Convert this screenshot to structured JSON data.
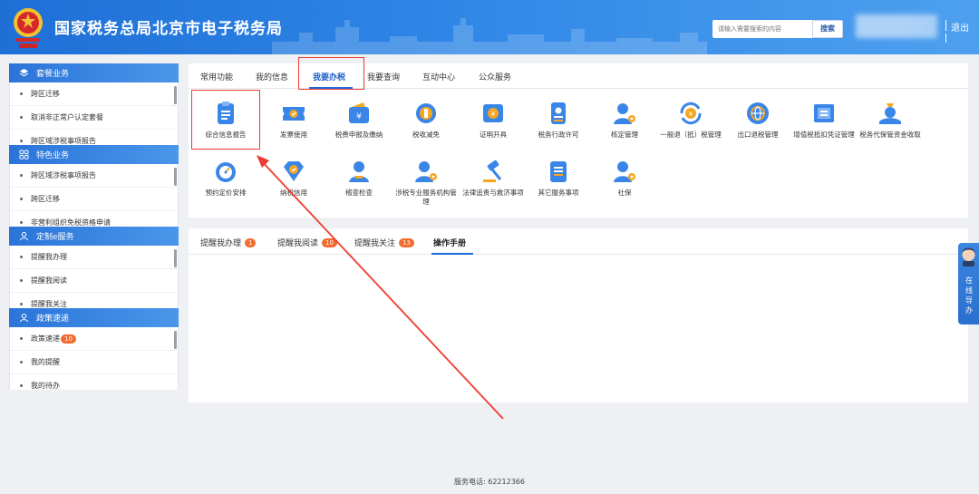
{
  "header": {
    "site_title": "国家税务总局北京市电子税务局",
    "search_placeholder": "请输入需要搜索的内容",
    "search_button": "搜索",
    "logout": "退出"
  },
  "sidebar": {
    "groups": [
      {
        "title": "套餐业务",
        "icon": "layers-icon",
        "items": [
          "跨区迁移",
          "取消非正常户认定套餐",
          "跨区域涉税事项报告"
        ]
      },
      {
        "title": "特色业务",
        "icon": "grid-icon",
        "items": [
          "跨区域涉税事项报告",
          "跨区迁移",
          "非营利组织免税资格申请"
        ]
      },
      {
        "title": "定制e服务",
        "icon": "user-icon",
        "items": [
          "提醒我办理",
          "提醒我阅读",
          "提醒我关注"
        ]
      },
      {
        "title": "政策速递",
        "icon": "user-icon",
        "items": [
          "政策速递",
          "我的提醒",
          "我的待办"
        ],
        "badge": "10"
      }
    ]
  },
  "main": {
    "tabs": [
      "常用功能",
      "我的信息",
      "我要办税",
      "我要查询",
      "互动中心",
      "公众服务"
    ],
    "active_tab": "我要办税",
    "functions": [
      {
        "label": "综合信息报告",
        "icon": "clipboard-icon"
      },
      {
        "label": "发票使用",
        "icon": "invoice-ticket-icon"
      },
      {
        "label": "税费申报及缴纳",
        "icon": "wallet-yuan-icon"
      },
      {
        "label": "税收减免",
        "icon": "coin-stack-icon"
      },
      {
        "label": "证明开具",
        "icon": "certificate-yuan-icon"
      },
      {
        "label": "税务行政许可",
        "icon": "id-card-icon"
      },
      {
        "label": "核定管理",
        "icon": "person-gear-icon"
      },
      {
        "label": "一般退（抵）税管理",
        "icon": "refund-cycle-icon"
      },
      {
        "label": "出口退税管理",
        "icon": "globe-icon"
      },
      {
        "label": "增值税抵扣凭证管理",
        "icon": "voucher-icon"
      },
      {
        "label": "税务代保管资金收取",
        "icon": "money-bag-hand-icon"
      },
      {
        "label": "预约定价安排",
        "icon": "gauge-icon"
      },
      {
        "label": "纳税信用",
        "icon": "diamond-check-icon"
      },
      {
        "label": "稽查检查",
        "icon": "inspector-icon"
      },
      {
        "label": "涉税专业服务机构管理",
        "icon": "person-gear-icon"
      },
      {
        "label": "法律追责与救济事项",
        "icon": "gavel-icon"
      },
      {
        "label": "其它服务事项",
        "icon": "list-doc-icon"
      },
      {
        "label": "社保",
        "icon": "person-gear-icon"
      }
    ],
    "subtabs": [
      {
        "label": "提醒我办理",
        "count": "1"
      },
      {
        "label": "提醒我阅读",
        "count": "10"
      },
      {
        "label": "提醒我关注",
        "count": "13"
      },
      {
        "label": "操作手册",
        "count": ""
      }
    ],
    "active_subtab": "操作手册"
  },
  "guide": {
    "text": "在线导办"
  },
  "footer": {
    "phone_text": "服务电话: 62212366"
  },
  "colors": {
    "brand_blue": "#2a74da",
    "badge_orange": "#f36a2e",
    "annotation_red": "#ee3b2f"
  }
}
